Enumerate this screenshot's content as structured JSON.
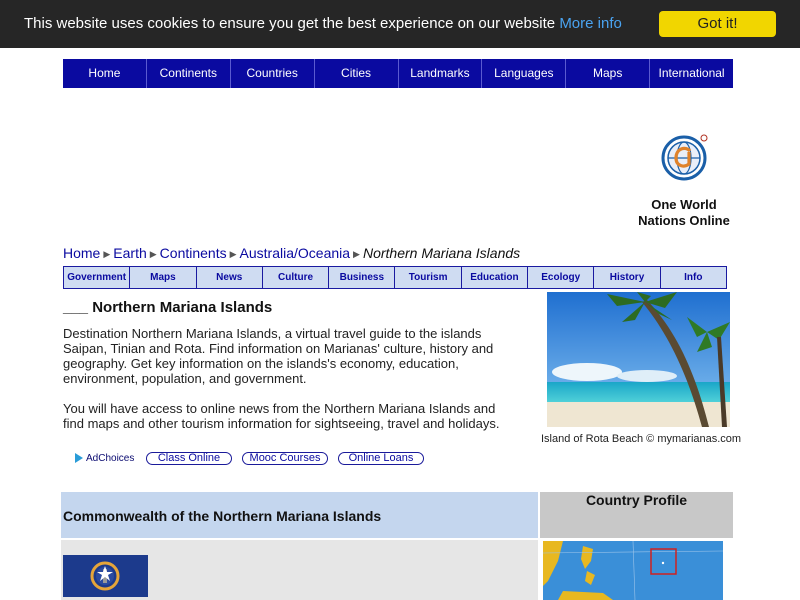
{
  "cookie": {
    "text": "This website uses cookies to ensure you get the best experience on our website",
    "more_info": "More info",
    "button": "Got it!"
  },
  "topnav": [
    "Home",
    "Continents",
    "Countries",
    "Cities",
    "Landmarks",
    "Languages",
    "Maps",
    "International"
  ],
  "logo": {
    "line1": "One World",
    "line2": "Nations Online"
  },
  "breadcrumb": {
    "items": [
      "Home",
      "Earth",
      "Continents",
      "Australia/Oceania"
    ],
    "current": "Northern Mariana Islands"
  },
  "subnav": [
    "Government",
    "Maps",
    "News",
    "Culture",
    "Business",
    "Tourism",
    "Education",
    "Ecology",
    "History",
    "Info"
  ],
  "main": {
    "heading": "___ Northern Mariana Islands",
    "para1": "Destination Northern Mariana Islands, a virtual travel guide to the islands Saipan, Tinian and Rota. Find information on Marianas' culture, history and geography. Get key information on the islands's economy, education, environment, population, and government.",
    "para2": "You will have access to online news from the Northern Mariana Islands and find maps and other tourism information for sightseeing, travel and holidays."
  },
  "photo": {
    "caption": "Island of Rota Beach © mymarianas.com"
  },
  "ads": {
    "adchoices": "AdChoices",
    "links": [
      "Class Online",
      "Mooc Courses",
      "Online Loans"
    ]
  },
  "profile": {
    "official_name": "Commonwealth of the Northern Mariana Islands",
    "country_profile": "Country Profile"
  },
  "colors": {
    "cookie_bg": "#262626",
    "cookie_button": "#f1d600",
    "nav_blue": "#0a0aa0",
    "profile_blue": "#c4d6ee"
  }
}
